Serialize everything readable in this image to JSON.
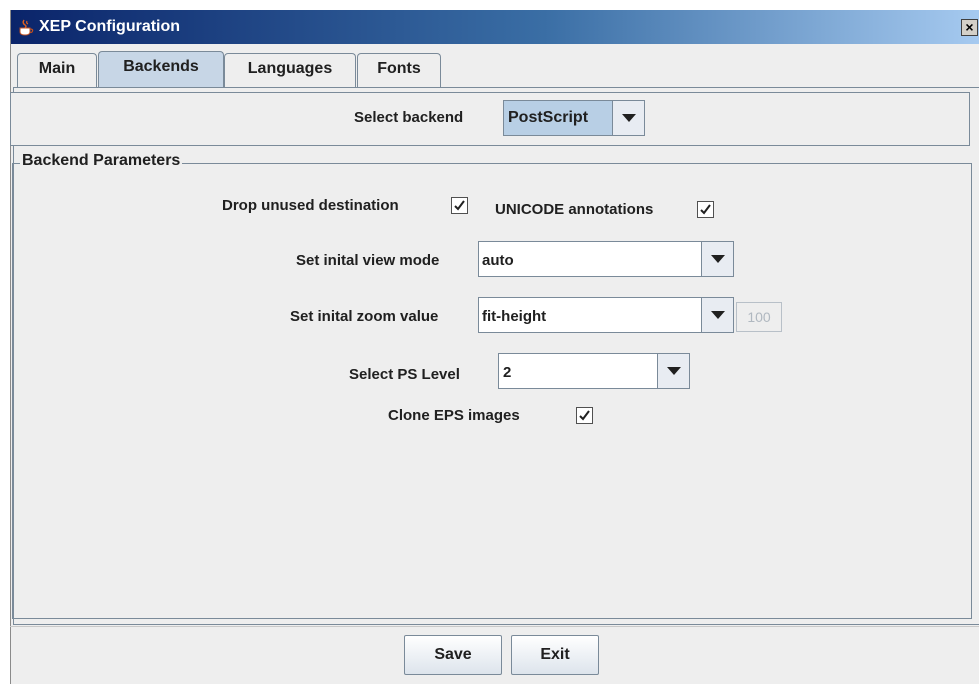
{
  "window": {
    "title": "XEP Configuration",
    "close_label": "×"
  },
  "tabs": [
    {
      "label": "Main",
      "active": false
    },
    {
      "label": "Backends",
      "active": true
    },
    {
      "label": "Languages",
      "active": false
    },
    {
      "label": "Fonts",
      "active": false
    }
  ],
  "backend": {
    "label": "Select backend",
    "value": "PostScript"
  },
  "params": {
    "legend": "Backend Parameters",
    "drop_unused": {
      "label": "Drop unused destination",
      "checked": true
    },
    "unicode_annotations": {
      "label": "UNICODE annotations",
      "checked": true
    },
    "view_mode": {
      "label": "Set inital view mode",
      "value": "auto"
    },
    "zoom": {
      "label": "Set inital zoom value",
      "value": "fit-height",
      "percent": "100"
    },
    "ps_level": {
      "label": "Select PS Level",
      "value": "2"
    },
    "clone_eps": {
      "label": "Clone EPS images",
      "checked": true
    }
  },
  "buttons": {
    "save": "Save",
    "exit": "Exit"
  },
  "colors": {
    "title_start": "#0a246a",
    "title_end": "#a6caf0",
    "tab_active": "#c7d6e6",
    "panel": "#eeeeee"
  }
}
